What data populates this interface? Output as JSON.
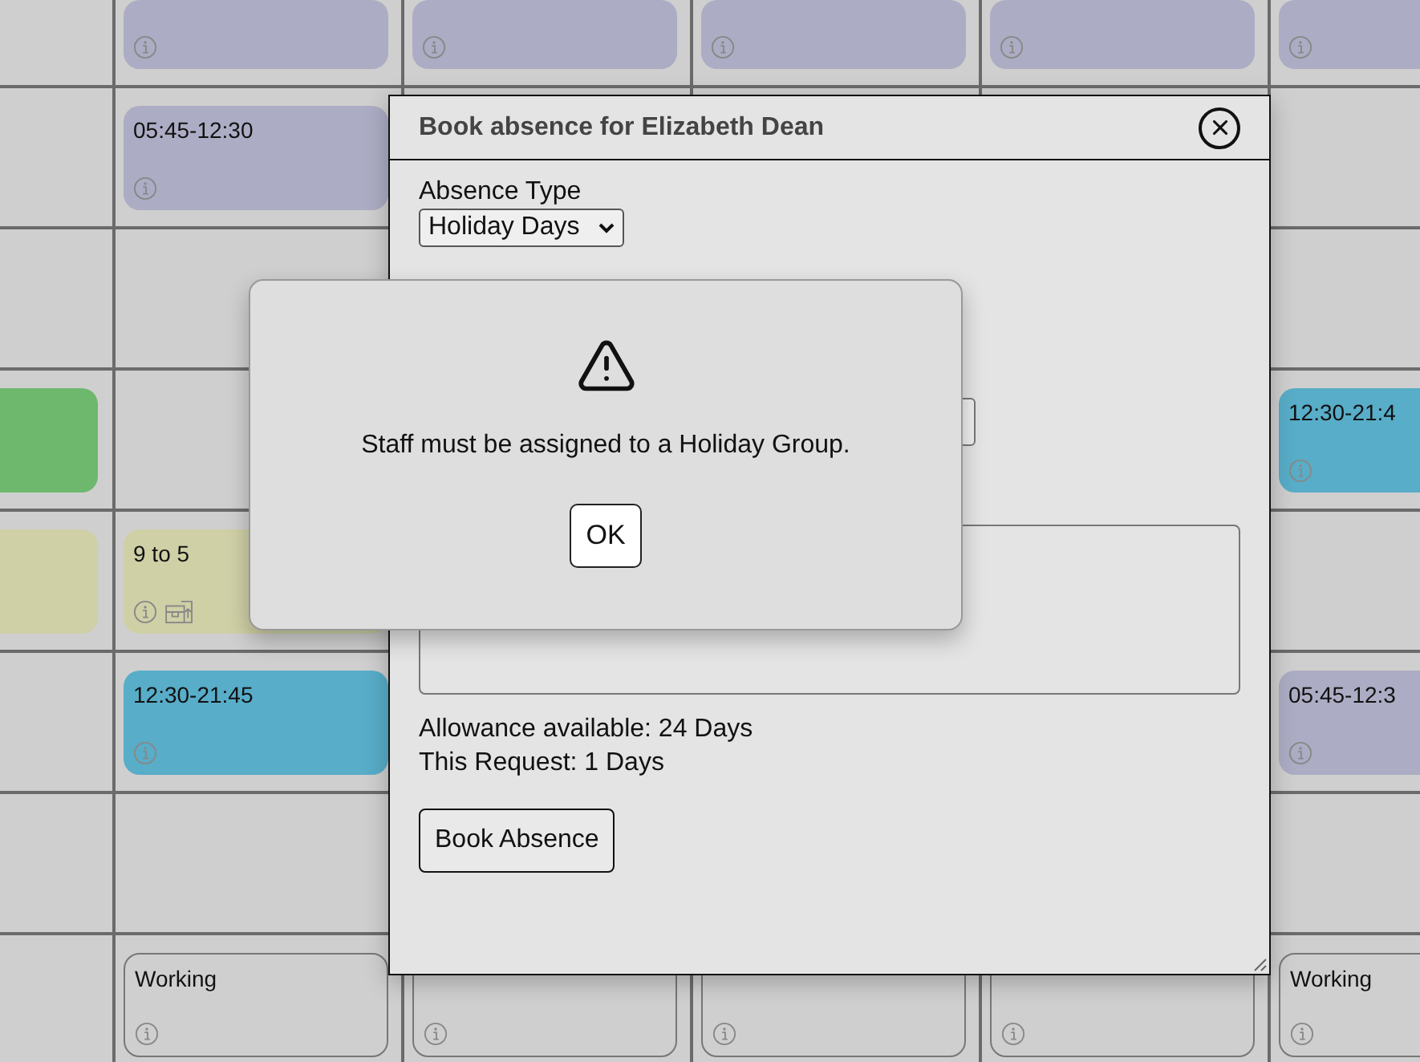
{
  "rota": {
    "rows": [
      {
        "cells": [
          {
            "kind": "empty"
          },
          {
            "kind": "shift",
            "color": "#acacc4",
            "extra_icon": false
          },
          {
            "kind": "shift",
            "color": "#acacc4",
            "extra_icon": false
          },
          {
            "kind": "shift",
            "color": "#acacc4",
            "extra_icon": false
          },
          {
            "kind": "shift",
            "color": "#acacc4",
            "extra_icon": false
          },
          {
            "kind": "shift",
            "color": "#acacc4",
            "extra_icon": false
          }
        ]
      },
      {
        "cells": [
          {
            "kind": "empty"
          },
          {
            "kind": "shift",
            "color": "#acacc4",
            "label": "05:45-12:30",
            "extra_icon": false
          },
          {
            "kind": "empty"
          },
          {
            "kind": "empty"
          },
          {
            "kind": "empty"
          },
          {
            "kind": "empty"
          }
        ]
      },
      {
        "cells": [
          {
            "kind": "empty"
          },
          {
            "kind": "empty"
          },
          {
            "kind": "empty"
          },
          {
            "kind": "empty"
          },
          {
            "kind": "empty"
          },
          {
            "kind": "empty"
          }
        ]
      },
      {
        "cells": [
          {
            "kind": "shift",
            "color": "#6db86c"
          },
          {
            "kind": "empty"
          },
          {
            "kind": "empty"
          },
          {
            "kind": "empty"
          },
          {
            "kind": "empty"
          },
          {
            "kind": "shift",
            "color": "#58adc8",
            "label": "12:30-21:4",
            "extra_icon": false
          }
        ]
      },
      {
        "cells": [
          {
            "kind": "shift",
            "color": "#cfd0a6"
          },
          {
            "kind": "shift",
            "color": "#cfd0a6",
            "label": "9 to 5",
            "extra_icon": true
          },
          {
            "kind": "empty"
          },
          {
            "kind": "empty"
          },
          {
            "kind": "empty"
          },
          {
            "kind": "empty"
          }
        ]
      },
      {
        "cells": [
          {
            "kind": "empty"
          },
          {
            "kind": "shift",
            "color": "#58adc8",
            "label": "12:30-21:45",
            "extra_icon": false
          },
          {
            "kind": "empty"
          },
          {
            "kind": "empty"
          },
          {
            "kind": "empty"
          },
          {
            "kind": "shift",
            "color": "#acacc4",
            "label": "05:45-12:3",
            "extra_icon": false
          }
        ]
      },
      {
        "cells": [
          {
            "kind": "empty"
          },
          {
            "kind": "empty"
          },
          {
            "kind": "empty"
          },
          {
            "kind": "empty"
          },
          {
            "kind": "empty"
          },
          {
            "kind": "empty"
          }
        ]
      },
      {
        "cells": [
          {
            "kind": "empty"
          },
          {
            "kind": "outline",
            "label": "Working",
            "extra_icon": false
          },
          {
            "kind": "outline",
            "extra_icon": false
          },
          {
            "kind": "outline",
            "extra_icon": false
          },
          {
            "kind": "outline",
            "extra_icon": false
          },
          {
            "kind": "outline",
            "label": "Working",
            "extra_icon": false
          }
        ]
      }
    ]
  },
  "absence_dialog": {
    "title": "Book absence for Elizabeth Dean",
    "absence_type_label": "Absence Type",
    "absence_type_value": "Holiday Days",
    "allowance": "Allowance available: 24 Days",
    "request": "This Request: 1 Days",
    "submit": "Book Absence"
  },
  "alert": {
    "message": "Staff must be assigned to a Holiday Group.",
    "ok": "OK"
  }
}
